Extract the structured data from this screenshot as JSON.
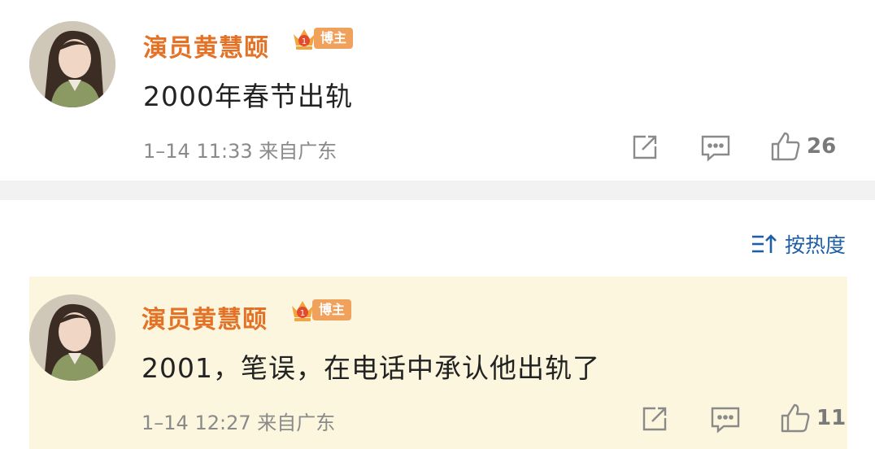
{
  "posts": [
    {
      "author": "演员黄慧颐",
      "badge": "博主",
      "content": "2000年春节出轨",
      "meta": "1–14 11:33 来自广东",
      "likes": "26"
    },
    {
      "author": "演员黄慧颐",
      "badge": "博主",
      "content": "2001，笔误，在电话中承认他出轨了",
      "meta": "1–14 12:27 来自广东",
      "likes": "11"
    }
  ],
  "sort": {
    "label": "按热度"
  },
  "colors": {
    "author": "#e47226",
    "link": "#1f5fa7",
    "highlight": "#fbf6dd"
  }
}
